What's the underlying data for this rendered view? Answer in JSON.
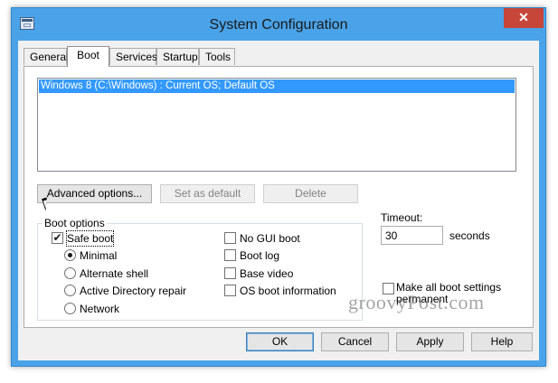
{
  "window": {
    "title": "System Configuration",
    "close_glyph": "✕"
  },
  "tabs": [
    {
      "label": "General"
    },
    {
      "label": "Boot"
    },
    {
      "label": "Services"
    },
    {
      "label": "Startup"
    },
    {
      "label": "Tools"
    }
  ],
  "active_tab": "Boot",
  "os_list": {
    "items": [
      "Windows 8 (C:\\Windows) : Current OS; Default OS"
    ],
    "selected_index": 0
  },
  "os_buttons": {
    "advanced": "Advanced options...",
    "set_default": "Set as default",
    "delete": "Delete"
  },
  "boot_options": {
    "title": "Boot options",
    "safe_boot": {
      "label": "Safe boot",
      "checked": true,
      "check_glyph": "✔"
    },
    "radios": [
      {
        "label": "Minimal",
        "selected": true
      },
      {
        "label": "Alternate shell",
        "selected": false
      },
      {
        "label": "Active Directory repair",
        "selected": false
      },
      {
        "label": "Network",
        "selected": false
      }
    ],
    "right_checks": [
      {
        "label": "No GUI boot",
        "checked": false
      },
      {
        "label": "Boot log",
        "checked": false
      },
      {
        "label": "Base video",
        "checked": false
      },
      {
        "label": "OS boot information",
        "checked": false
      }
    ]
  },
  "timeout": {
    "label": "Timeout:",
    "value": "30",
    "unit": "seconds"
  },
  "make_permanent": {
    "label": "Make all boot settings permanent",
    "checked": false
  },
  "dialog_buttons": {
    "ok": "OK",
    "cancel": "Cancel",
    "apply": "Apply",
    "help": "Help"
  },
  "watermark": "groovyPost.com",
  "colors": {
    "titlebar": "#4aa3e8",
    "selection": "#3399ff",
    "close": "#c7463a"
  }
}
